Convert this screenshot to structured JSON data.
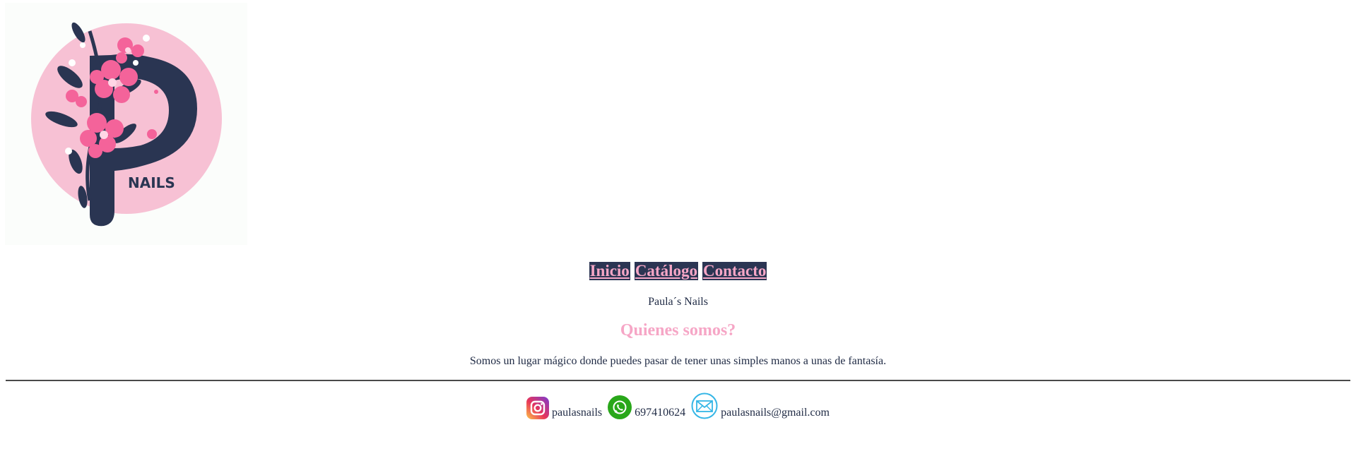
{
  "logo": {
    "text": "NAILS",
    "icon": "pink-flower-p-logo"
  },
  "nav": {
    "items": [
      {
        "label": "Inicio"
      },
      {
        "label": "Catálogo"
      },
      {
        "label": "Contacto"
      }
    ]
  },
  "brand": {
    "name": "Paula´s Nails"
  },
  "about": {
    "title": "Quienes somos?",
    "text": "Somos un lugar mágico donde puedes pasar de tener unas simples manos a unas de fantasía."
  },
  "contacts": {
    "instagram": {
      "icon": "instagram-icon",
      "label": "paulasnails"
    },
    "whatsapp": {
      "icon": "whatsapp-icon",
      "label": "697410624"
    },
    "email": {
      "icon": "mail-icon",
      "label": "paulasnails@gmail.com"
    }
  },
  "colors": {
    "navy": "#2b3553",
    "pink": "#f6a6c6",
    "logo_circle": "#f7c1d4",
    "whatsapp": "#29a71a",
    "mail": "#35b6e6"
  }
}
